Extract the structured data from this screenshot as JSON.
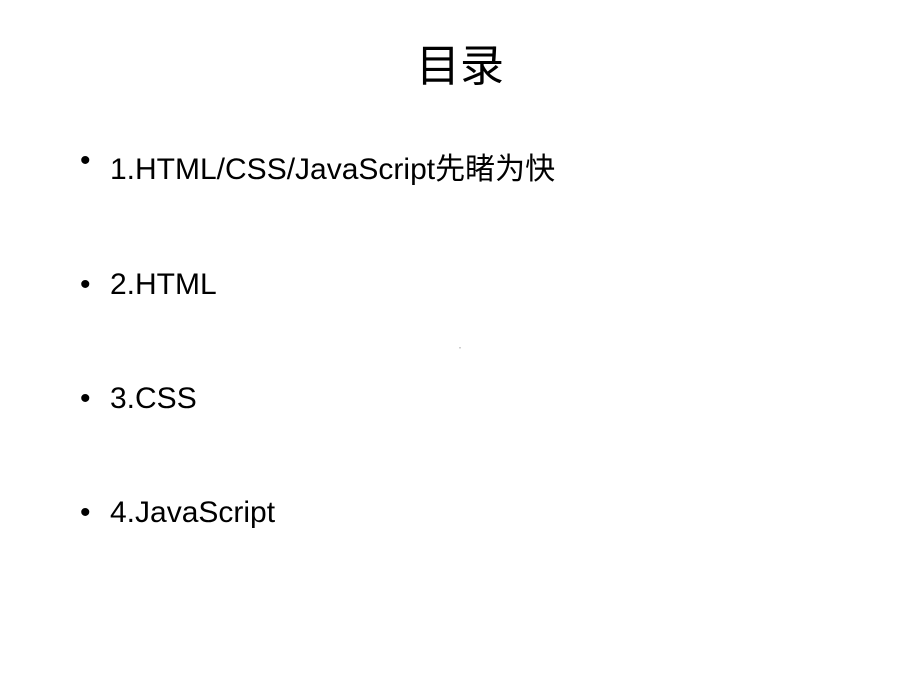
{
  "slide": {
    "title": "目录",
    "items": [
      "1.HTML/CSS/JavaScript先睹为快",
      "2.HTML",
      "3.CSS",
      "4.JavaScript"
    ],
    "center_mark": "."
  }
}
